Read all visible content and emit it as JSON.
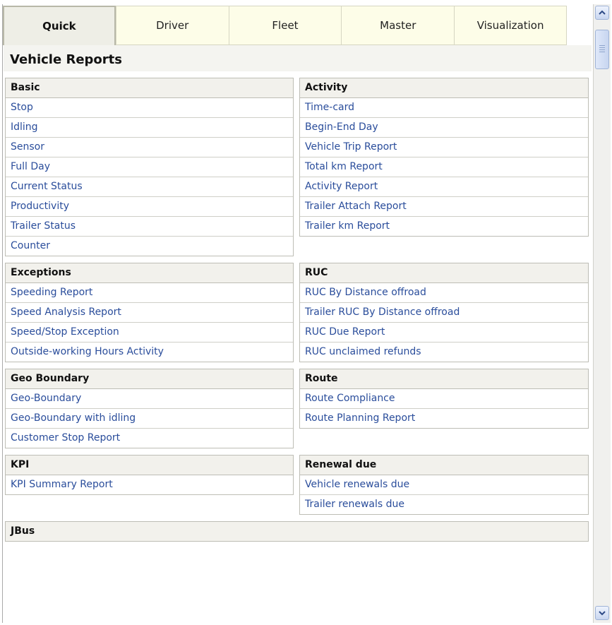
{
  "tabs": [
    {
      "label": "Quick",
      "active": true
    },
    {
      "label": "Driver"
    },
    {
      "label": "Fleet"
    },
    {
      "label": "Master"
    },
    {
      "label": "Visualization"
    }
  ],
  "page_title": "Vehicle Reports",
  "sections": {
    "basic": {
      "title": "Basic",
      "items": [
        "Stop",
        "Idling",
        "Sensor",
        "Full Day",
        "Current Status",
        "Productivity",
        "Trailer Status",
        "Counter"
      ]
    },
    "activity": {
      "title": "Activity",
      "items": [
        "Time-card",
        "Begin-End Day",
        "Vehicle Trip Report",
        "Total km Report",
        "Activity Report",
        "Trailer Attach Report",
        "Trailer km Report"
      ]
    },
    "exceptions": {
      "title": "Exceptions",
      "items": [
        "Speeding Report",
        "Speed Analysis Report",
        "Speed/Stop Exception",
        "Outside-working Hours Activity"
      ]
    },
    "ruc": {
      "title": "RUC",
      "items": [
        "RUC By Distance offroad",
        "Trailer RUC By Distance offroad",
        "RUC Due Report",
        "RUC unclaimed refunds"
      ]
    },
    "geo": {
      "title": "Geo Boundary",
      "items": [
        "Geo-Boundary",
        "Geo-Boundary with idling",
        "Customer Stop Report"
      ]
    },
    "route": {
      "title": "Route",
      "items": [
        "Route Compliance",
        "Route Planning Report"
      ]
    },
    "kpi": {
      "title": "KPI",
      "items": [
        "KPI Summary Report"
      ]
    },
    "renewal": {
      "title": "Renewal due",
      "items": [
        "Vehicle renewals due",
        "Trailer renewals due"
      ]
    },
    "jbus": {
      "title": "JBus",
      "items": []
    }
  },
  "scrollbar": {
    "up_icon": "chevron-up-icon",
    "down_icon": "chevron-down-icon"
  }
}
